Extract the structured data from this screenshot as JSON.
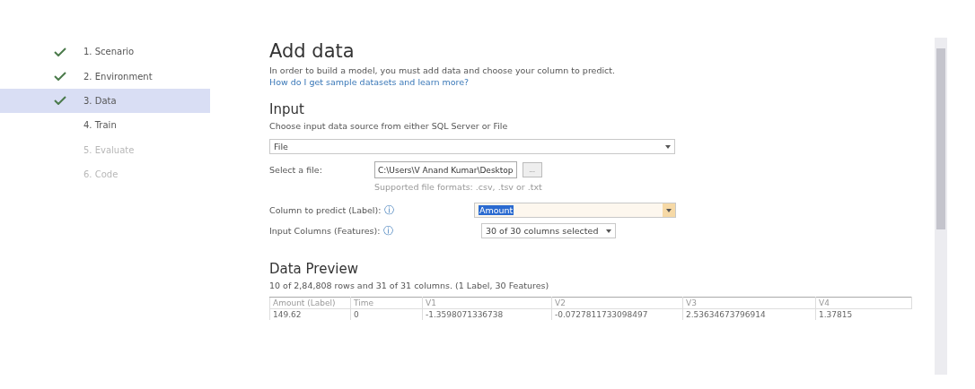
{
  "steps": [
    {
      "label": "1. Scenario",
      "done": true,
      "selected": false,
      "disabled": false
    },
    {
      "label": "2. Environment",
      "done": true,
      "selected": false,
      "disabled": false
    },
    {
      "label": "3. Data",
      "done": true,
      "selected": true,
      "disabled": false
    },
    {
      "label": "4. Train",
      "done": false,
      "selected": false,
      "disabled": false
    },
    {
      "label": "5. Evaluate",
      "done": false,
      "selected": false,
      "disabled": true
    },
    {
      "label": "6. Code",
      "done": false,
      "selected": false,
      "disabled": true
    }
  ],
  "title": "Add data",
  "description": "In order to build a model, you must add data and choose your column to predict.",
  "help_link": "How do I get sample datasets and learn more?",
  "input": {
    "heading": "Input",
    "description": "Choose input data source from either SQL Server or File",
    "source": "File",
    "file_label": "Select a file:",
    "file_path": "C:\\Users\\V Anand Kumar\\Desktop",
    "browse": "...",
    "formats_note": "Supported file formats: .csv, .tsv or .txt",
    "label_field": {
      "label": "Column to predict (Label):",
      "info": "ⓘ",
      "value": "Amount"
    },
    "features_field": {
      "label": "Input Columns (Features):",
      "info": "ⓘ",
      "value": "30 of 30 columns selected"
    }
  },
  "preview": {
    "heading": "Data Preview",
    "summary": "10 of 2,84,808 rows and 31 of 31 columns. (1 Label, 30 Features)",
    "columns": [
      "Amount (Label)",
      "Time",
      "V1",
      "V2",
      "V3",
      "V4"
    ],
    "rows": [
      [
        "149.62",
        "0",
        "-1.3598071336738",
        "-0.0727811733098497",
        "2.53634673796914",
        "1.37815"
      ]
    ]
  }
}
